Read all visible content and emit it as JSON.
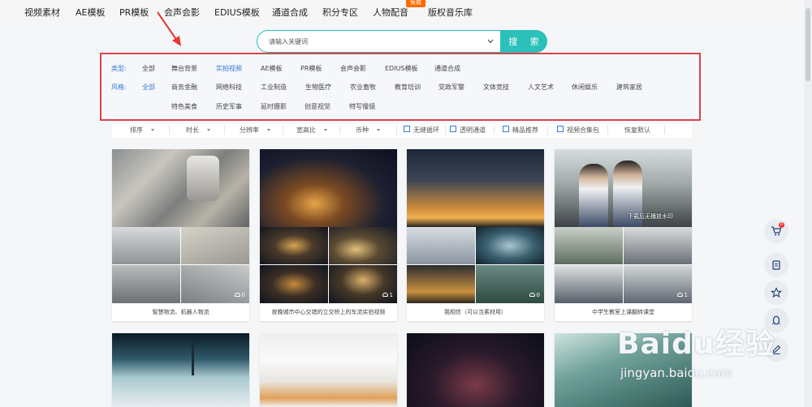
{
  "nav": {
    "items": [
      "视频素材",
      "AE模板",
      "PR模板",
      "会声会影",
      "EDIUS模板",
      "通道合成",
      "积分专区",
      "人物配音",
      "版权音乐库"
    ],
    "free_badge": "免费"
  },
  "search": {
    "placeholder": "请输入关键词",
    "button_label": "搜 索"
  },
  "filters": {
    "type_label": "类型:",
    "type_options": [
      "全部",
      "舞台背景",
      "实拍视频",
      "AE模板",
      "PR模板",
      "会声会影",
      "EDIUS模板",
      "通道合成"
    ],
    "type_active": "实拍视频",
    "style_label": "风格:",
    "style_row1": [
      "全部",
      "商务金融",
      "网络科技",
      "工业制造",
      "生物医疗",
      "农业畜牧",
      "教育培训",
      "党政军警",
      "文体竞技",
      "人文艺术",
      "休闲娱乐",
      "建筑家居"
    ],
    "style_row2": [
      "特色美食",
      "历史军事",
      "延时摄影",
      "创意视觉",
      "特写慢镜"
    ],
    "style_active": "全部"
  },
  "sortbar": {
    "dropdowns": [
      "排序",
      "时长",
      "分辨率",
      "宽高比",
      "币种"
    ],
    "checkboxes": [
      "无缝循环",
      "透明通道",
      "精品推荐",
      "视频合集包"
    ],
    "reset_label": "恢复默认"
  },
  "cards": [
    {
      "caption": "智慧物流、机器人物流",
      "downloads": "0"
    },
    {
      "caption": "夜晚城市中心交错的立交桥上的车流实拍视频",
      "downloads": "1"
    },
    {
      "caption": "我相信（可以当素材用）",
      "downloads": "0"
    },
    {
      "caption": "中学生教室上课翻转课堂",
      "downloads": "1"
    },
    {
      "caption": "",
      "downloads": ""
    },
    {
      "caption": "",
      "downloads": ""
    },
    {
      "caption": "",
      "downloads": ""
    },
    {
      "caption": "",
      "downloads": ""
    }
  ],
  "thumb_watermark": "下载后无播放水印",
  "side_tools": {
    "cart_count": "0",
    "icons": [
      "cart-icon",
      "clipboard-icon",
      "star-icon",
      "qq-icon",
      "edit-icon"
    ]
  },
  "watermark": {
    "brand": "Baidu经验",
    "url": "jingyan.baidu.com"
  },
  "colors": {
    "accent": "#2bc0ba",
    "link": "#3a7bd5",
    "highlight_border": "#d9434a",
    "badge": "#ff6a00"
  }
}
